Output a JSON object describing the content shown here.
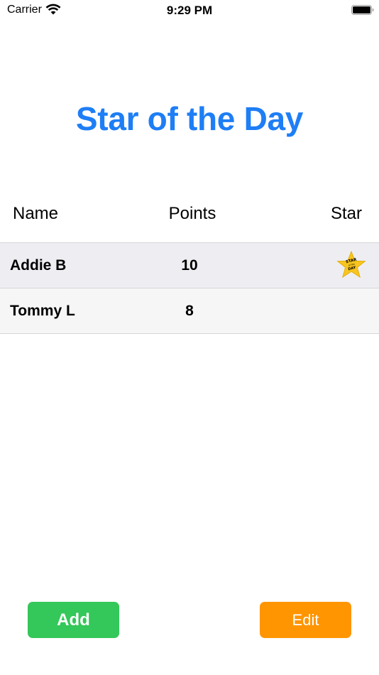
{
  "status_bar": {
    "carrier": "Carrier",
    "time": "9:29 PM",
    "wifi_icon": "wifi-icon",
    "battery_icon": "battery-icon"
  },
  "title": "Star of the Day",
  "columns": {
    "name": "Name",
    "points": "Points",
    "star": "Star"
  },
  "rows": [
    {
      "name": "Addie B",
      "points": "10",
      "star": true,
      "star_badge_text": [
        "STAR",
        "of the",
        "DAY"
      ]
    },
    {
      "name": "Tommy L",
      "points": "8",
      "star": false
    }
  ],
  "buttons": {
    "add": "Add",
    "edit": "Edit"
  },
  "colors": {
    "title": "#1e7ef5",
    "add_button": "#34c759",
    "edit_button": "#ff9500",
    "star": "#f7c51e"
  }
}
